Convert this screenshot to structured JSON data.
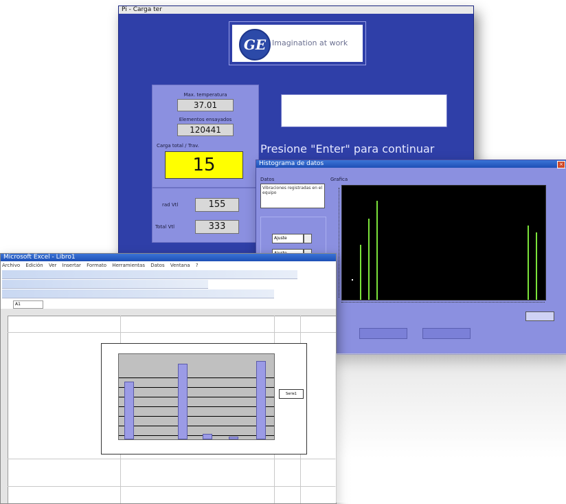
{
  "main_window": {
    "title": "Pi - Carga ter",
    "logo_text": "Imagination at work",
    "left_panel": {
      "field1_label": "Max. temperatura",
      "field1_value": "37.01",
      "field2_label": "Elementos ensayados",
      "field2_value": "120441",
      "field3_label": "Carga total / Trav.",
      "field3_value": "15",
      "stat1_label": "rad Vtl",
      "stat1_value": "155",
      "stat2_label": "Total  Vtl",
      "stat2_value": "333"
    },
    "prompt_text": "Presione \"Enter\" para continuar"
  },
  "graph_window": {
    "title": "Histograma de datos",
    "left_label": "Datos",
    "left_text": "Vibraciones registradas en el equipo",
    "right_label": "Grafica",
    "dropdown1": "Ajuste",
    "dropdown2": "Ajuste"
  },
  "spreadsheet_window": {
    "title": "Microsoft Excel - Libro1",
    "menu": [
      "Archivo",
      "Edición",
      "Ver",
      "Insertar",
      "Formato",
      "Herramientas",
      "Datos",
      "Ventana",
      "?"
    ],
    "cell_ref": "A1",
    "legend_label": "Serie1"
  },
  "colors": {
    "main_bg": "#2f3fa8",
    "panel_bg": "#8b90e0",
    "highlight_yellow": "#ffff00",
    "graph_green": "#7be33a",
    "chart_bar": "#9b9be6",
    "chart_plot_bg": "#c0c0c0"
  }
}
